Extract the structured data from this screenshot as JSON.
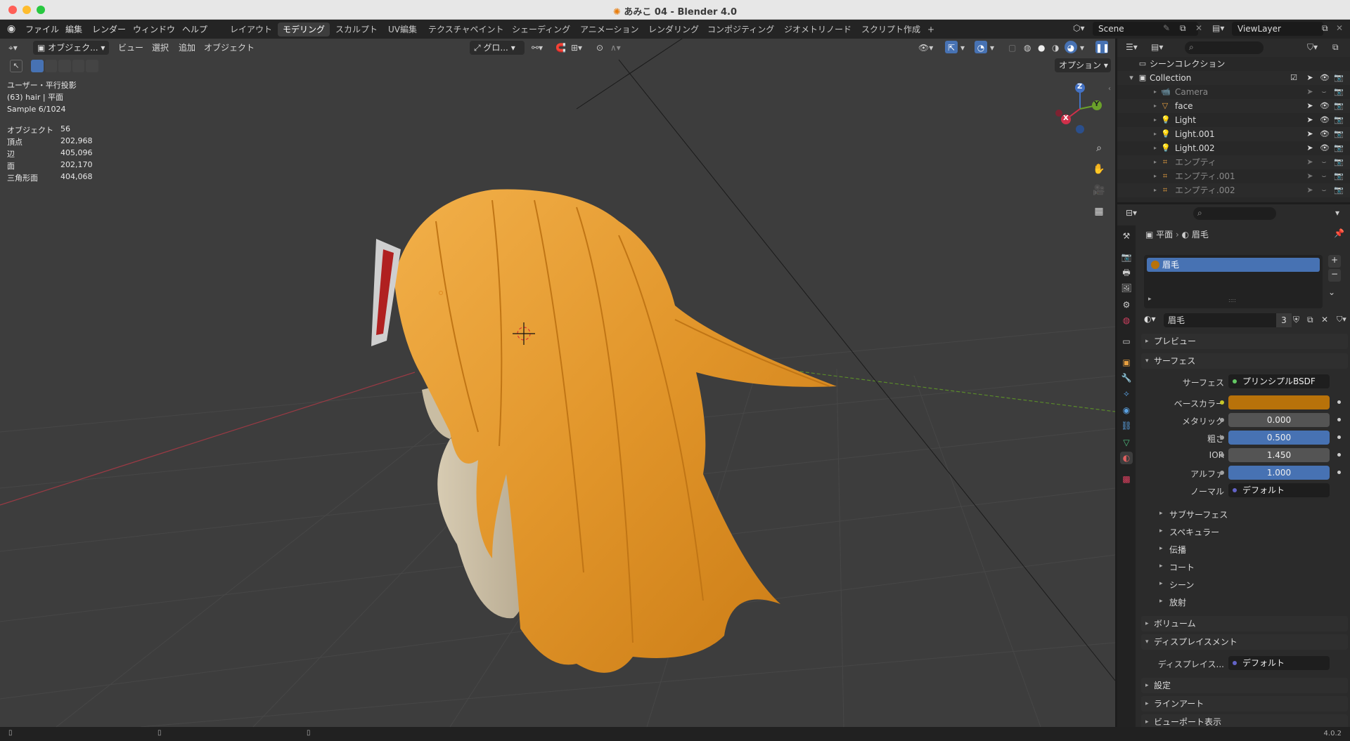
{
  "window": {
    "title": "あみこ 04 - Blender 4.0",
    "title_icon": "blender-file-icon"
  },
  "menus": [
    "ファイル",
    "編集",
    "レンダー",
    "ウィンドウ",
    "ヘルプ"
  ],
  "workspaces": [
    {
      "label": "レイアウト",
      "active": false
    },
    {
      "label": "モデリング",
      "active": true
    },
    {
      "label": "スカルプト",
      "active": false
    },
    {
      "label": "UV編集",
      "active": false
    },
    {
      "label": "テクスチャペイント",
      "active": false
    },
    {
      "label": "シェーディング",
      "active": false
    },
    {
      "label": "アニメーション",
      "active": false
    },
    {
      "label": "レンダリング",
      "active": false
    },
    {
      "label": "コンポジティング",
      "active": false
    },
    {
      "label": "ジオメトリノード",
      "active": false
    },
    {
      "label": "スクリプト作成",
      "active": false
    }
  ],
  "add_workspace": "+",
  "scene": {
    "value": "Scene"
  },
  "view_layer": {
    "value": "ViewLayer"
  },
  "viewport": {
    "mode": "オブジェク...",
    "menus": [
      "ビュー",
      "選択",
      "追加",
      "オブジェクト"
    ],
    "transform_orientation": "グロ...",
    "options": "オプション",
    "overlay_lines": [
      "ユーザー・平行投影",
      "(63) hair | 平面",
      "Sample 6/1024"
    ],
    "stats": [
      {
        "k": "オブジェクト",
        "v": "56"
      },
      {
        "k": "頂点",
        "v": "202,968"
      },
      {
        "k": "辺",
        "v": "405,096"
      },
      {
        "k": "面",
        "v": "202,170"
      },
      {
        "k": "三角形面",
        "v": "404,068"
      }
    ],
    "gizmo": {
      "x": "X",
      "y": "Y",
      "z": "Z"
    }
  },
  "outliner": {
    "root": "シーンコレクション",
    "collection": "Collection",
    "items": [
      {
        "name": "Camera",
        "dim": true,
        "icon": "camera-icon"
      },
      {
        "name": "face",
        "dim": false,
        "icon": "mesh-icon"
      },
      {
        "name": "Light",
        "dim": false,
        "icon": "light-icon"
      },
      {
        "name": "Light.001",
        "dim": false,
        "icon": "light-icon"
      },
      {
        "name": "Light.002",
        "dim": false,
        "icon": "light-icon"
      },
      {
        "name": "エンプティ",
        "dim": true,
        "icon": "empty-icon"
      },
      {
        "name": "エンプティ.001",
        "dim": true,
        "icon": "empty-icon"
      },
      {
        "name": "エンプティ.002",
        "dim": true,
        "icon": "empty-icon"
      }
    ]
  },
  "properties": {
    "breadcrumb": {
      "object": "平面",
      "material": "眉毛"
    },
    "slot": "眉毛",
    "material_name": "眉毛",
    "user_count": "3",
    "sections": {
      "preview": "プレビュー",
      "surface": "サーフェス",
      "volume": "ボリューム",
      "displacement": "ディスプレイスメント",
      "settings": "設定",
      "lineart": "ラインアート",
      "viewport_display": "ビューポート表示"
    },
    "surface_rows": [
      {
        "label": "サーフェス",
        "value": "プリンシプルBSDF",
        "style": "dark"
      },
      {
        "label": "ベースカラー",
        "value": "",
        "style": "color"
      },
      {
        "label": "メタリック",
        "value": "0.000",
        "style": "plain"
      },
      {
        "label": "粗さ",
        "value": "0.500",
        "style": "blue"
      },
      {
        "label": "IOR",
        "value": "1.450",
        "style": "plain"
      },
      {
        "label": "アルファ",
        "value": "1.000",
        "style": "blue"
      },
      {
        "label": "ノーマル",
        "value": "デフォルト",
        "style": "dark"
      }
    ],
    "subpanels": [
      "サブサーフェス",
      "スペキュラー",
      "伝播",
      "コート",
      "シーン",
      "放射"
    ],
    "displacement_row": {
      "label": "ディスプレイス...",
      "value": "デフォルト"
    },
    "base_color": "#b8720a"
  },
  "status": {
    "version": "4.0.2"
  },
  "colors": {
    "accent": "#4772b3",
    "hair": "#e69a2a",
    "selection": "#4772b3"
  }
}
